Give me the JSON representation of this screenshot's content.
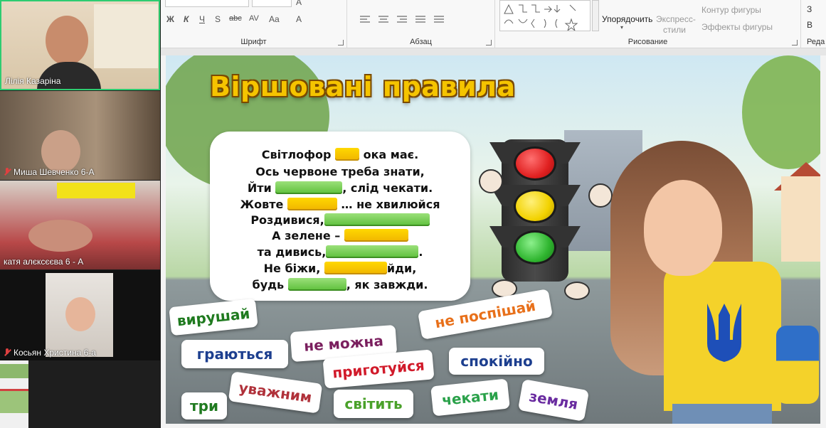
{
  "ribbon": {
    "font_label": "Шрифт",
    "paragraph_label": "Абзац",
    "drawing_label": "Рисование",
    "editing_label": "Реда",
    "arrange_label": "Упорядочить",
    "quick_styles_label_1": "Экспресс-",
    "quick_styles_label_2": "стили",
    "shape_outline_label": "Контур фигуры",
    "shape_effects_label": "Эффекты фигуры",
    "fmt_italic": "К",
    "fmt_bold": "Ж",
    "fmt_underline": "Ч",
    "fmt_shadow": "S",
    "fmt_strike": "abc",
    "fmt_spacing": "AV",
    "fmt_case": "Aa",
    "fmt_clear": "A",
    "right_btn_1": "З",
    "right_btn_2": "В"
  },
  "participants": [
    {
      "name": "Лілія Казаріна",
      "muted": false
    },
    {
      "name": "Миша Шевченко 6-А",
      "muted": true
    },
    {
      "name": "катя алєксєєва 6 - А",
      "muted": false
    },
    {
      "name": "Косьян Христина 6-а",
      "muted": true
    }
  ],
  "slide": {
    "title": "Віршовані правила",
    "poem": [
      {
        "before": "Світлофор",
        "gap": "y",
        "after": "ока має."
      },
      {
        "before": "Ось червоне треба знати,",
        "gap": "",
        "after": ""
      },
      {
        "before": "Йти",
        "gap": "g",
        "after": ", слід чекати."
      },
      {
        "before": "Жовте",
        "gap": "y",
        "after": "… не хвилюйся"
      },
      {
        "before": "Роздивися,",
        "gap": "g",
        "after": ""
      },
      {
        "before": "А зелене –",
        "gap": "y",
        "after": ""
      },
      {
        "before": "та дивись,",
        "gap": "g",
        "after": "."
      },
      {
        "before": "Не біжи,",
        "gap": "y",
        "after": "йди,"
      },
      {
        "before": "будь",
        "gap": "g",
        "after": ", як завжди."
      }
    ],
    "chips": [
      {
        "text": "вирушай",
        "color": "#1f7a1f"
      },
      {
        "text": "граються",
        "color": "#1d3f8f"
      },
      {
        "text": "не можна",
        "color": "#7a1f5e"
      },
      {
        "text": "не поспішай",
        "color": "#e8701a"
      },
      {
        "text": "приготуйся",
        "color": "#d11a2a"
      },
      {
        "text": "спокійно",
        "color": "#1d3f8f"
      },
      {
        "text": "три",
        "color": "#1f7a1f"
      },
      {
        "text": "уважним",
        "color": "#b0313a"
      },
      {
        "text": "світить",
        "color": "#4aa12a"
      },
      {
        "text": "чекати",
        "color": "#2aa14a"
      },
      {
        "text": "земля",
        "color": "#6a2ca0"
      }
    ]
  },
  "colors": {
    "title_yellow": "#f5c400",
    "light_red": "#e02020",
    "light_yellow": "#f2d200",
    "light_green": "#2fb52f",
    "active_speaker_border": "#2ecc71"
  }
}
